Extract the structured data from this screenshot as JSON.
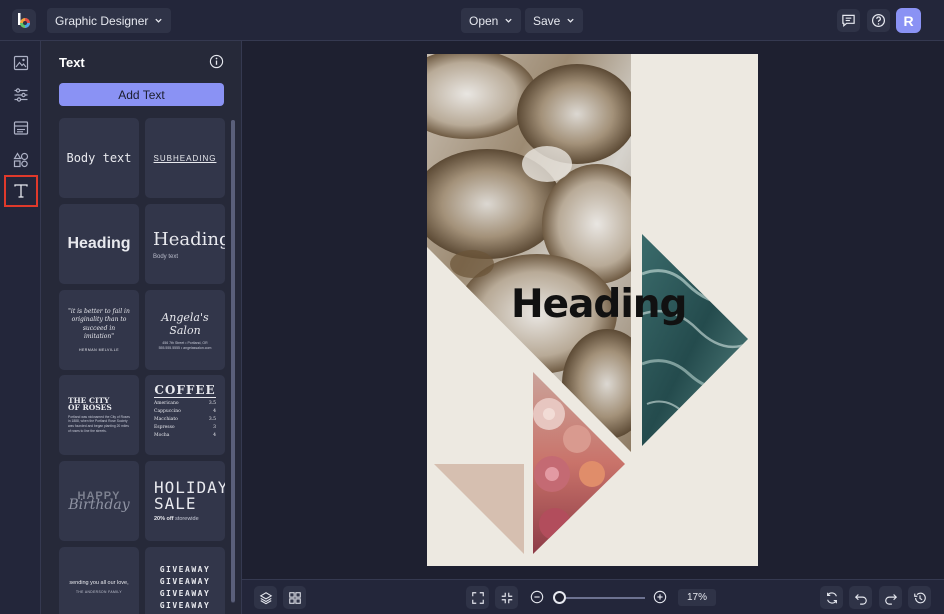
{
  "topbar": {
    "project_name": "Graphic Designer",
    "open_label": "Open",
    "save_label": "Save",
    "avatar_initial": "R"
  },
  "panel": {
    "title": "Text",
    "add_text_label": "Add Text",
    "templates": {
      "body_text": "Body text",
      "subheading": "SUBHEADING",
      "heading_sans": "Heading",
      "heading_serif": "Heading",
      "heading_serif_sub": "Body text",
      "quote_text": "\"it is better to fail in originality than to succeed in imitation\"",
      "quote_author": "HERMAN MELVILLE",
      "salon_name": "Angela's Salon",
      "salon_address": "456 7th Street • Portland, OR",
      "salon_contact": "555.555.5555 • angelassalon.com",
      "city_title_1": "THE CITY",
      "city_title_2": "OF ROSES",
      "city_body": "Portland was nicknamed the City of Roses in 1888, when the Portland Rose Society was founded and began planting 20 miles of roses to line the streets.",
      "coffee_title": "COFFEE",
      "coffee_menu": [
        {
          "item": "Americano",
          "price": "3.5"
        },
        {
          "item": "Cappuccino",
          "price": "4"
        },
        {
          "item": "Macchiato",
          "price": "3.5"
        },
        {
          "item": "Espresso",
          "price": "3"
        },
        {
          "item": "Mocha",
          "price": "4"
        }
      ],
      "happy": "HAPPY",
      "birthday": "Birthday",
      "holiday_1": "HOLIDAY",
      "holiday_2": "SALE",
      "holiday_off": "20% off",
      "holiday_storewide": "storewide",
      "love_text": "sending you all our love,",
      "love_sign": "THE ANDERSON FAMILY",
      "giveaway": "GIVEAWAY"
    }
  },
  "canvas": {
    "heading": "Heading",
    "triangle_colors": [
      "#d6bfb0",
      "#2e5a5c"
    ]
  },
  "bottombar": {
    "zoom_percent": 17,
    "zoom_label": "17%"
  },
  "colors": {
    "accent": "#8a92f4",
    "active_outline": "#e0392b"
  }
}
